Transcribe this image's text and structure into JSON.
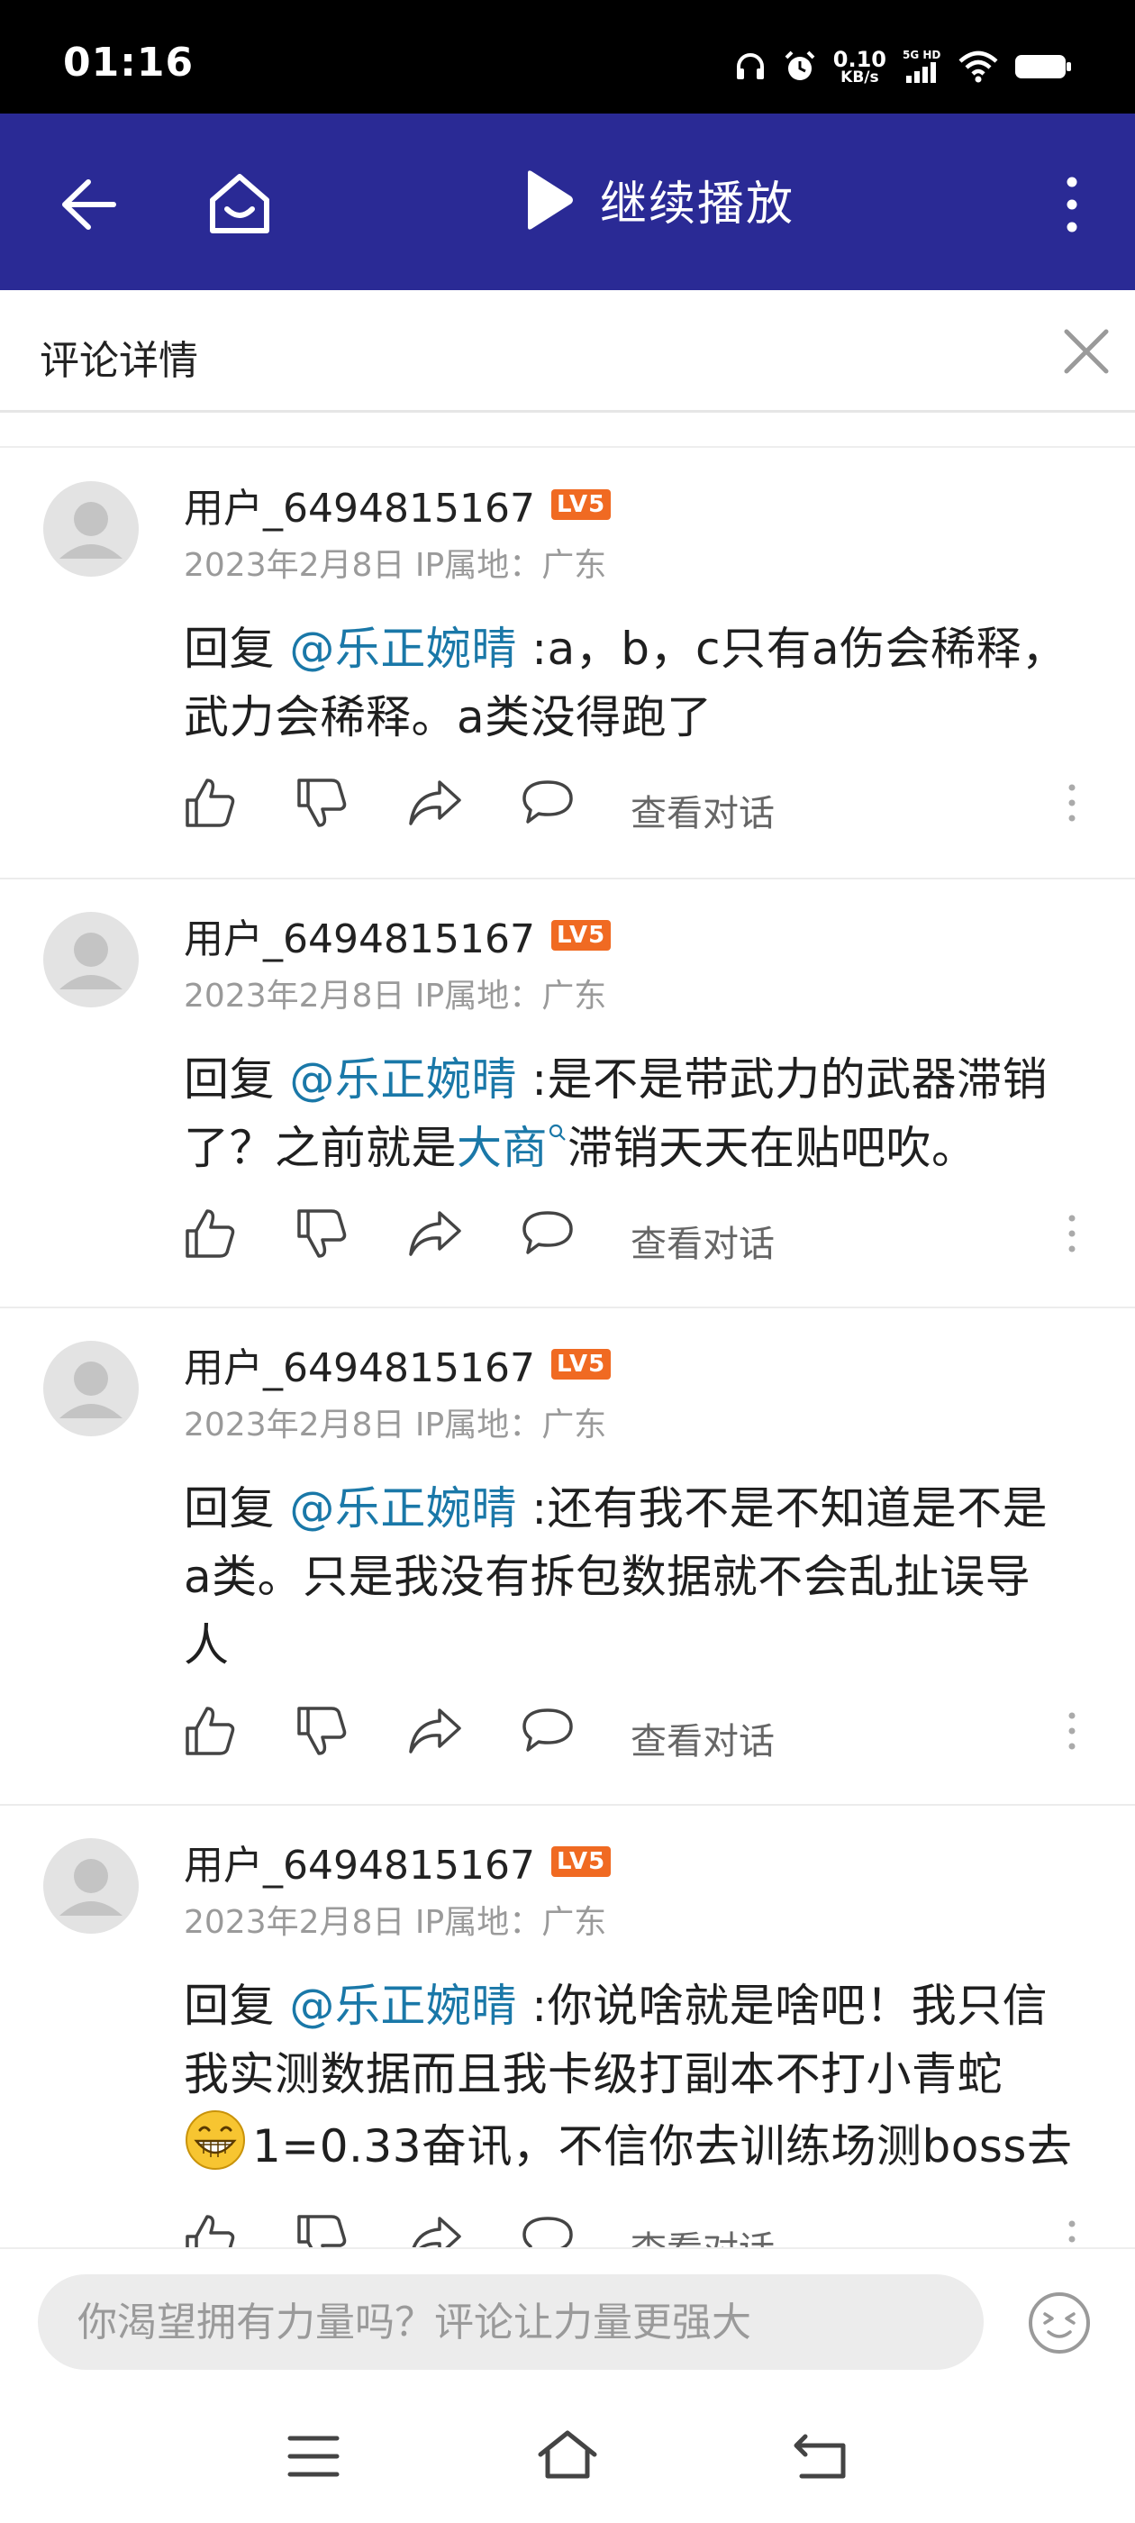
{
  "status_bar": {
    "time": "01:16",
    "net_speed_value": "0.10",
    "net_speed_unit": "KB/s",
    "signal_label": "5G HD",
    "icons": [
      "headphones-icon",
      "alarm-icon",
      "signal-icon",
      "wifi-icon",
      "battery-icon"
    ]
  },
  "top_nav": {
    "continue_play_label": "继续播放",
    "background_color": "#2a2a95"
  },
  "panel": {
    "title": "评论详情"
  },
  "comments": [
    {
      "username": "用户_6494815167",
      "level": "LV5",
      "meta": "2023年2月8日 IP属地：广东",
      "reply_prefix": "回复 ",
      "mention": "@乐正婉晴",
      "text_line1": " :a，b，c只有a伤会稀释，",
      "text_line2": "武力会稀释。a类没得跑了",
      "view_conversation": "查看对话"
    },
    {
      "username": "用户_6494815167",
      "level": "LV5",
      "meta": "2023年2月8日 IP属地：广东",
      "reply_prefix": "回复 ",
      "mention": "@乐正婉晴",
      "text_line1": " :是不是带武力的武器滞销",
      "text_line2_pre": "了？之前就是",
      "link_word": "大商",
      "text_line2_post": "滞销天天在贴吧吹。",
      "view_conversation": "查看对话"
    },
    {
      "username": "用户_6494815167",
      "level": "LV5",
      "meta": "2023年2月8日 IP属地：广东",
      "reply_prefix": "回复 ",
      "mention": "@乐正婉晴",
      "text_line1": " :还有我不是不知道是不是",
      "text_line2": "a类。只是我没有拆包数据就不会乱扯误导",
      "text_line3": "人",
      "view_conversation": "查看对话"
    },
    {
      "username": "用户_6494815167",
      "level": "LV5",
      "meta": "2023年2月8日 IP属地：广东",
      "reply_prefix": "回复 ",
      "mention": "@乐正婉晴",
      "text_line1": " :你说啥就是啥吧！我只信",
      "text_line2": "我实测数据而且我卡级打副本不打小青蛇",
      "text_line3": "1=0.33奋讯，不信你去训练场测boss去",
      "view_conversation": "查看对话"
    }
  ],
  "input_bar": {
    "placeholder": "你渴望拥有力量吗？评论让力量更强大"
  },
  "colors": {
    "accent": "#2a2a95",
    "mention": "#1a78a8",
    "level_badge": "#f06a22",
    "meta_text": "#9a9a9a"
  }
}
